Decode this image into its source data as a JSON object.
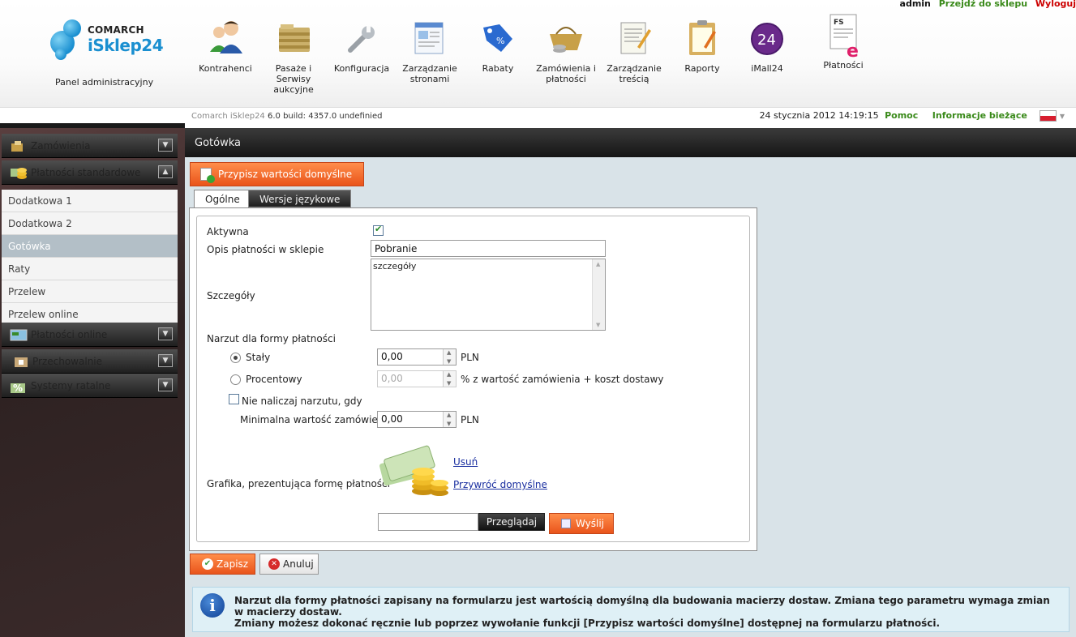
{
  "header": {
    "user": "admin",
    "go_to_shop": "Przejdź do sklepu",
    "logout": "Wyloguj",
    "logo_company": "COMARCH",
    "logo_product": "iSklep24",
    "panel_label": "Panel administracyjny",
    "nav": [
      {
        "label": "Kontrahenci",
        "icon": "contractors-icon"
      },
      {
        "label": "Pasaże i Serwisy aukcyjne",
        "icon": "folders-icon"
      },
      {
        "label": "Konfiguracja",
        "icon": "wrench-icon"
      },
      {
        "label": "Zarządzanie stronami",
        "icon": "page-edit-icon"
      },
      {
        "label": "Rabaty",
        "icon": "discount-tag-icon"
      },
      {
        "label": "Zamówienia i płatności",
        "icon": "basket-icon"
      },
      {
        "label": "Zarządzanie treścią",
        "icon": "content-edit-icon"
      },
      {
        "label": "Raporty",
        "icon": "clipboard-icon"
      },
      {
        "label": "iMall24",
        "icon": "imall24-icon",
        "badge": "24"
      },
      {
        "label": "Płatności",
        "icon": "invoice-icon",
        "badge": "FS"
      }
    ]
  },
  "status_bar": {
    "build_prefix": "Comarch iSklep24",
    "build": "6.0 build: 4357.0  undefinied",
    "datetime": "24 stycznia 2012 14:19:15",
    "help": "Pomoc",
    "current_info": "Informacje bieżące"
  },
  "sidebar": {
    "sections": [
      {
        "label": "Zamówienia",
        "icon": "orders-icon",
        "expanded": false
      },
      {
        "label": "Płatności standardowe",
        "icon": "coins-icon",
        "expanded": true
      },
      {
        "label": "Płatności online",
        "icon": "online-payment-icon",
        "expanded": false
      },
      {
        "label": "Przechowalnie",
        "icon": "storage-icon",
        "expanded": false
      },
      {
        "label": "Systemy ratalne",
        "icon": "percent-icon",
        "expanded": false
      }
    ],
    "items": [
      {
        "label": "Dodatkowa 1"
      },
      {
        "label": "Dodatkowa 2"
      },
      {
        "label": "Gotówka",
        "active": true
      },
      {
        "label": "Raty"
      },
      {
        "label": "Przelew"
      },
      {
        "label": "Przelew online"
      }
    ]
  },
  "main": {
    "title": "Gotówka",
    "assign_defaults": "Przypisz wartości domyślne",
    "tabs": [
      {
        "label": "Ogólne",
        "active": true
      },
      {
        "label": "Wersje językowe",
        "active": false
      }
    ],
    "form": {
      "active_label": "Aktywna",
      "active_checked": true,
      "description_label": "Opis płatności w sklepie",
      "description_value": "Pobranie",
      "details_label": "Szczegóły",
      "details_value": "szczegóły",
      "surcharge_label": "Narzut dla formy płatności",
      "fixed_label": "Stały",
      "fixed_value": "0,00",
      "fixed_unit": "PLN",
      "percent_label": "Procentowy",
      "percent_value": "0,00",
      "percent_unit": "% z wartość zamówienia + koszt dostawy",
      "no_surcharge_label": "Nie naliczaj narzutu, gdy",
      "min_order_label": "Minimalna wartość zamówienia",
      "min_order_value": "0,00",
      "min_order_unit": "PLN",
      "graphic_label": "Grafika, prezentująca formę płatności",
      "remove_link": "Usuń",
      "restore_link": "Przywróć domyślne",
      "browse_label": "Przeglądaj",
      "send_label": "Wyślij"
    },
    "save_label": "Zapisz",
    "cancel_label": "Anuluj",
    "info_text_1": "Narzut dla formy płatności zapisany na formularzu jest wartością domyślną dla budowania macierzy dostaw. Zmiana tego parametru wymaga zmian w macierzy dostaw.",
    "info_text_2": "Zmiany możesz dokonać ręcznie lub poprzez wywołanie funkcji [Przypisz wartości domyślne] dostępnej na formularzu płatności."
  },
  "colors": {
    "accent_orange": "#f26a2a",
    "link_green": "#3a8a1a",
    "logout_red": "#cc0000",
    "sidebar_active": "#b3bfc7",
    "info_bg": "#dff0f6"
  }
}
